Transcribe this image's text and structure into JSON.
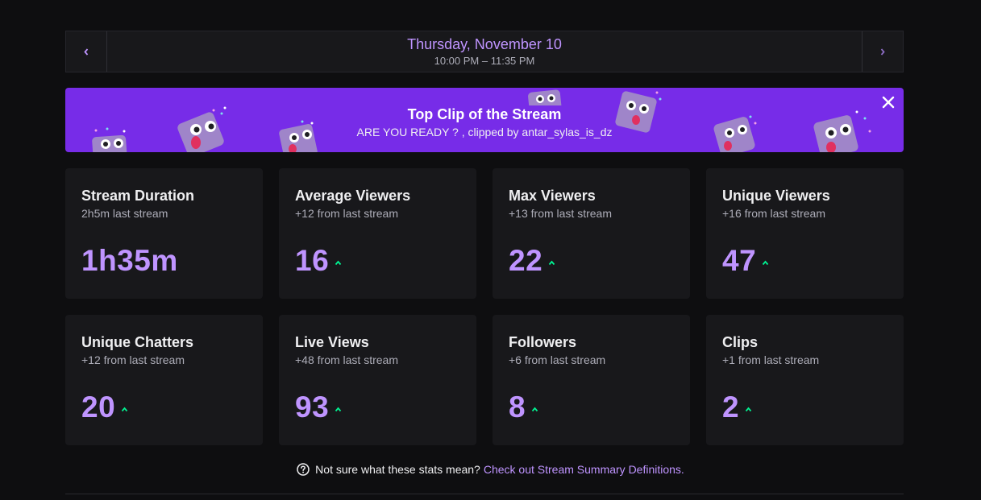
{
  "date_nav": {
    "date": "Thursday, November 10",
    "time_range": "10:00 PM – 11:35 PM",
    "prev_icon": "chevron-left-icon",
    "next_icon": "chevron-right-icon"
  },
  "banner": {
    "title": "Top Clip of the Stream",
    "subtitle": "ARE YOU READY ? , clipped by antar_sylas_is_dz",
    "close_icon": "close-icon",
    "background": "#772ce8"
  },
  "stats": [
    {
      "title": "Stream Duration",
      "subtitle": "2h5m last stream",
      "value": "1h35m",
      "trend": ""
    },
    {
      "title": "Average Viewers",
      "subtitle": "+12 from last stream",
      "value": "16",
      "trend": "up"
    },
    {
      "title": "Max Viewers",
      "subtitle": "+13 from last stream",
      "value": "22",
      "trend": "up"
    },
    {
      "title": "Unique Viewers",
      "subtitle": "+16 from last stream",
      "value": "47",
      "trend": "up"
    },
    {
      "title": "Unique Chatters",
      "subtitle": "+12 from last stream",
      "value": "20",
      "trend": "up"
    },
    {
      "title": "Live Views",
      "subtitle": "+48 from last stream",
      "value": "93",
      "trend": "up"
    },
    {
      "title": "Followers",
      "subtitle": "+6 from last stream",
      "value": "8",
      "trend": "up"
    },
    {
      "title": "Clips",
      "subtitle": "+1 from last stream",
      "value": "2",
      "trend": "up"
    }
  ],
  "help": {
    "text": "Not sure what these stats mean?",
    "link": "Check out Stream Summary Definitions.",
    "icon": "question-circle-icon"
  },
  "colors": {
    "accent": "#bf94ff",
    "trend_up": "#00f593",
    "card_bg": "#18181b",
    "page_bg": "#0e0e10"
  }
}
